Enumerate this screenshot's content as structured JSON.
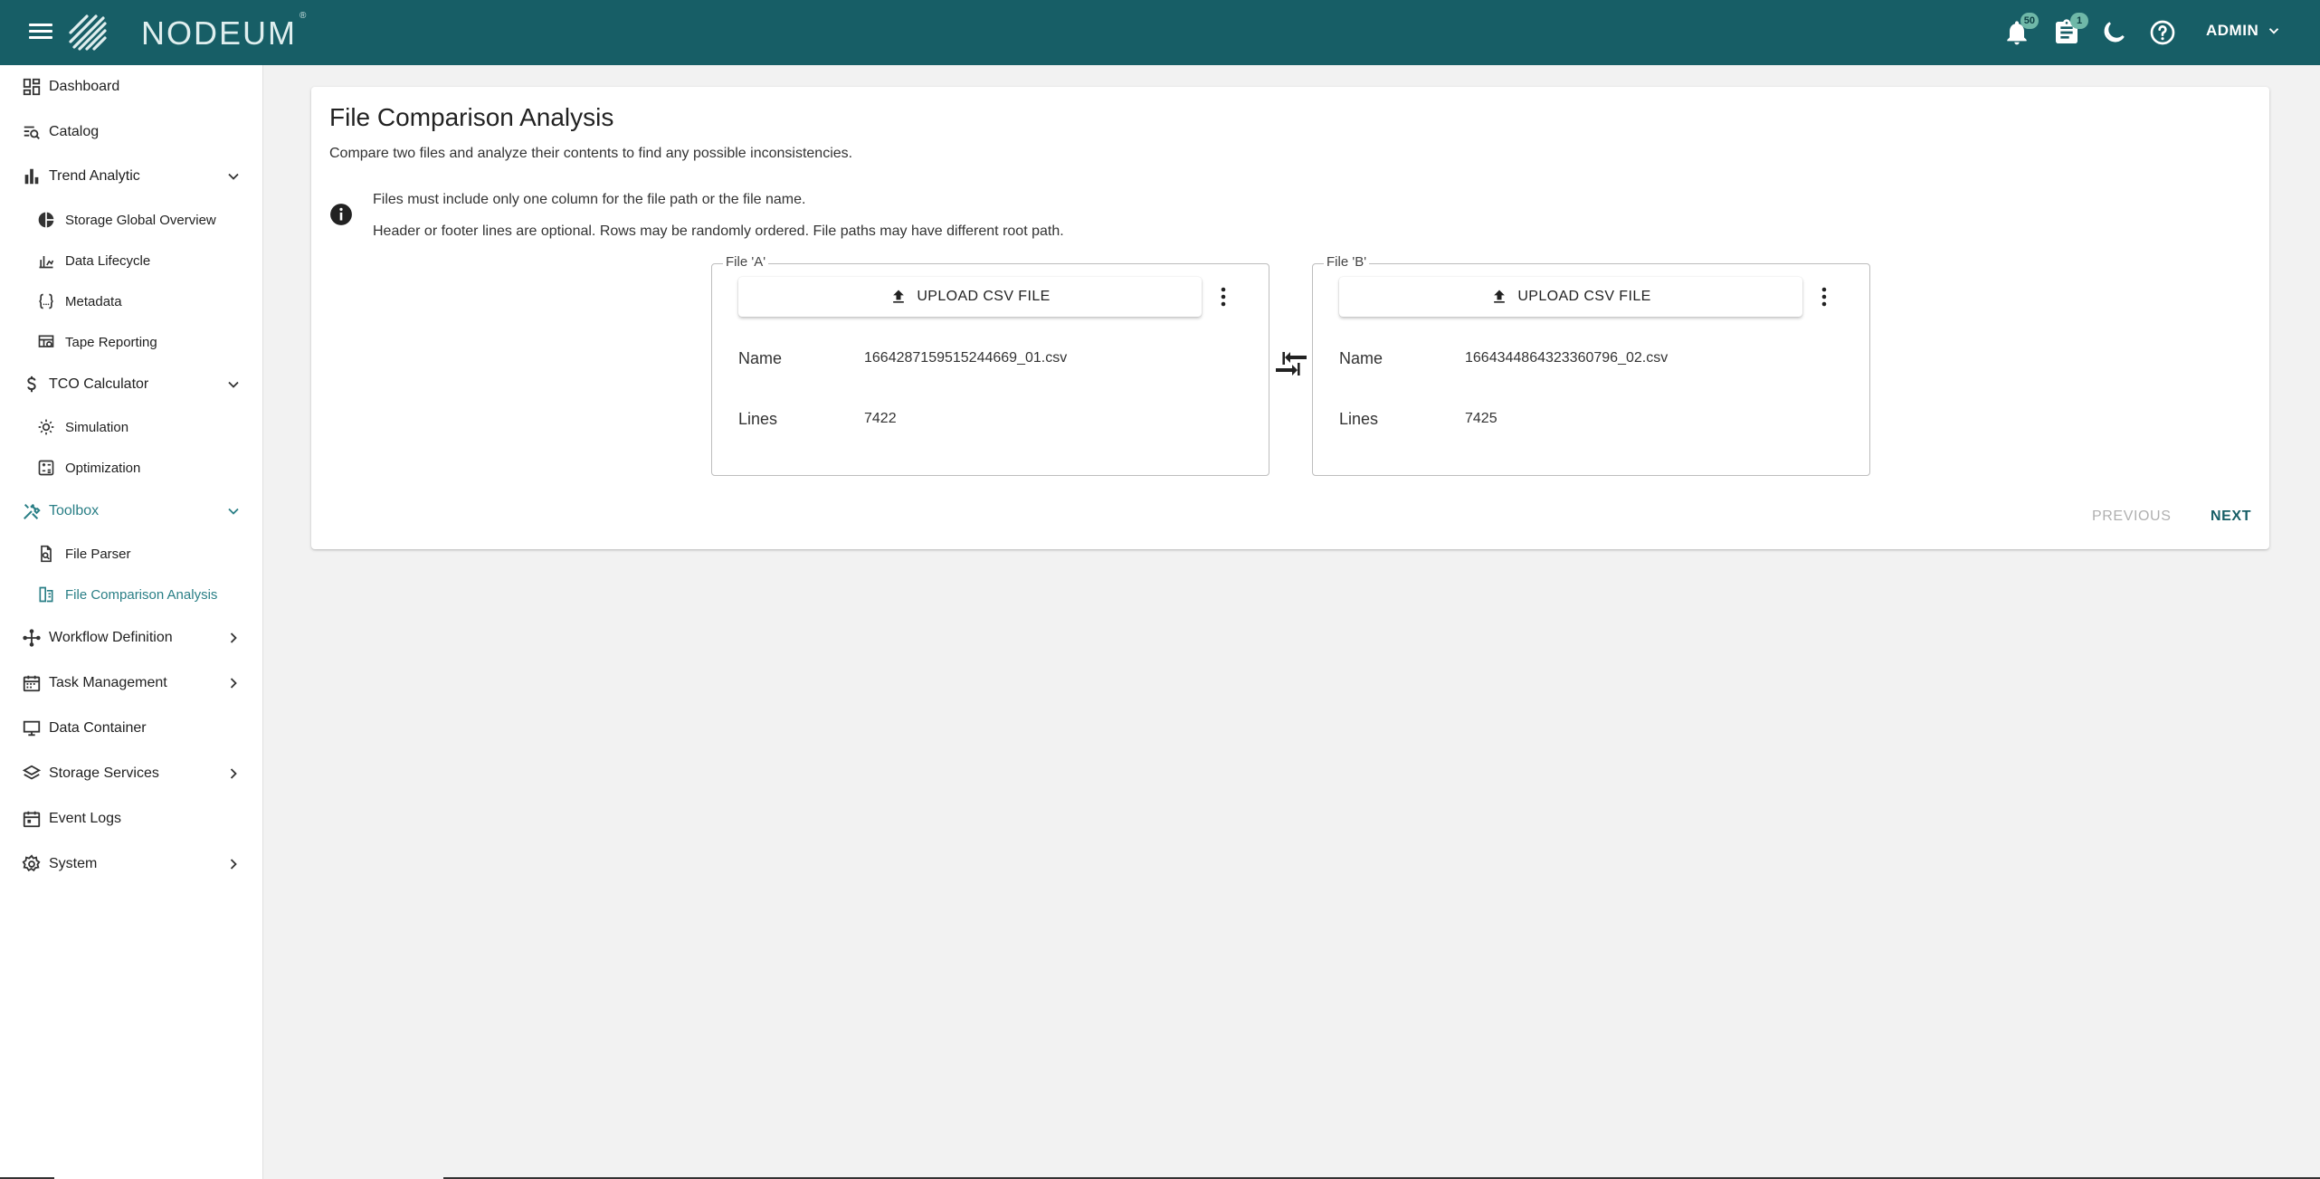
{
  "app": {
    "brand": "NODEUM",
    "brand_mark": "®"
  },
  "header": {
    "notifications_count": "50",
    "tasks_count": "1",
    "user_label": "ADMIN"
  },
  "sidebar": {
    "items": [
      {
        "label": "Dashboard",
        "icon": "dashboard-icon"
      },
      {
        "label": "Catalog",
        "icon": "catalog-icon"
      },
      {
        "label": "Trend Analytic",
        "icon": "bar-chart-icon",
        "expanded": true
      },
      {
        "label": "Storage Global Overview",
        "icon": "pie-chart-icon"
      },
      {
        "label": "Data Lifecycle",
        "icon": "lifecycle-icon"
      },
      {
        "label": "Metadata",
        "icon": "metadata-icon"
      },
      {
        "label": "Tape Reporting",
        "icon": "tape-report-icon"
      },
      {
        "label": "TCO Calculator",
        "icon": "dollar-icon",
        "expanded": true
      },
      {
        "label": "Simulation",
        "icon": "simulation-icon"
      },
      {
        "label": "Optimization",
        "icon": "calculator-icon"
      },
      {
        "label": "Toolbox",
        "icon": "tools-icon",
        "expanded": true,
        "active": true
      },
      {
        "label": "File Parser",
        "icon": "file-search-icon"
      },
      {
        "label": "File Comparison Analysis",
        "icon": "file-compare-icon",
        "active": true
      },
      {
        "label": "Workflow Definition",
        "icon": "workflow-icon"
      },
      {
        "label": "Task Management",
        "icon": "calendar-icon"
      },
      {
        "label": "Data Container",
        "icon": "monitor-icon"
      },
      {
        "label": "Storage Services",
        "icon": "layers-icon"
      },
      {
        "label": "Event Logs",
        "icon": "event-log-icon"
      },
      {
        "label": "System",
        "icon": "gear-icon"
      }
    ]
  },
  "main": {
    "title": "File Comparison Analysis",
    "subtitle": "Compare two files and analyze their contents to find any possible inconsistencies.",
    "info_line1": "Files must include only one column for the file path or the file name.",
    "info_line2": "Header or footer lines are optional. Rows may be randomly ordered. File paths may have different root path.",
    "file_a": {
      "legend": "File 'A'",
      "upload_label": "UPLOAD CSV FILE",
      "name_label": "Name",
      "name_value": "1664287159515244669_01.csv",
      "lines_label": "Lines",
      "lines_value": "7422"
    },
    "file_b": {
      "legend": "File 'B'",
      "upload_label": "UPLOAD CSV FILE",
      "name_label": "Name",
      "name_value": "1664344864323360796_02.csv",
      "lines_label": "Lines",
      "lines_value": "7425"
    },
    "previous_label": "PREVIOUS",
    "next_label": "NEXT"
  },
  "colors": {
    "header_bg": "#175e66",
    "active_nav": "#2a7f86",
    "badge": "#6fb8a8"
  }
}
